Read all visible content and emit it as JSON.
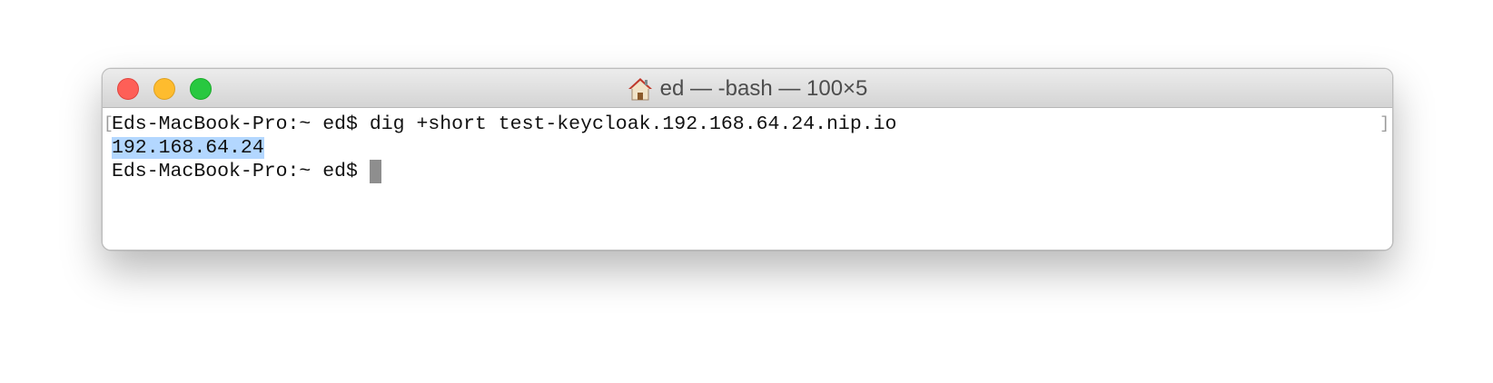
{
  "window": {
    "title": "ed — -bash — 100×5",
    "title_icon": "home-icon"
  },
  "terminal": {
    "line1": "Eds-MacBook-Pro:~ ed$ dig +short test-keycloak.192.168.64.24.nip.io",
    "line2": "192.168.64.24",
    "line3_prompt": "Eds-MacBook-Pro:~ ed$ ",
    "bracket_left": "[",
    "bracket_right": "]"
  },
  "colors": {
    "close": "#fe5f57",
    "minimize": "#febc2e",
    "zoom": "#28c840",
    "selection": "#b3d7ff",
    "cursor": "#8e8e8e"
  }
}
